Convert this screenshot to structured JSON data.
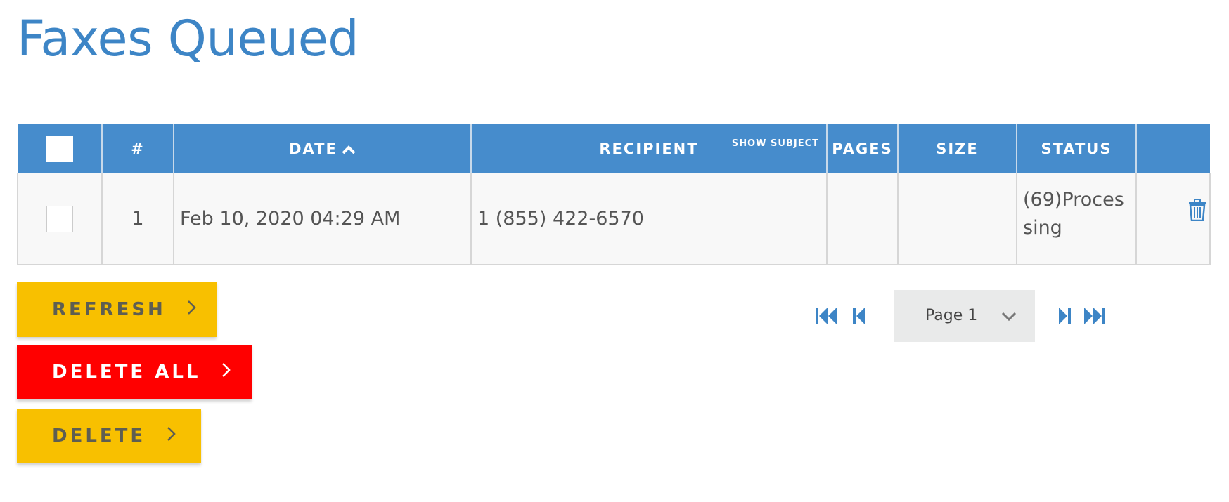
{
  "page": {
    "title": "Faxes Queued"
  },
  "table": {
    "headers": {
      "number": "#",
      "date": "DATE",
      "recipient": "RECIPIENT",
      "show_subject": "SHOW SUBJECT",
      "pages": "PAGES",
      "size": "SIZE",
      "status": "STATUS"
    },
    "sort": {
      "column": "DATE",
      "direction": "ascending",
      "icon": "chevron-up-icon"
    },
    "rows": [
      {
        "number": "1",
        "date": "Feb 10, 2020 04:29 AM",
        "recipient": "1 (855) 422-6570",
        "pages": "",
        "size": "",
        "status": "(69)Processing",
        "checked": false
      }
    ]
  },
  "actions": {
    "refresh": "REFRESH",
    "delete_all": "DELETE ALL",
    "delete": "DELETE"
  },
  "pagination": {
    "current_page": "Page 1",
    "icons": [
      "first-page-icon",
      "previous-page-icon",
      "next-page-icon",
      "last-page-icon"
    ]
  },
  "colors": {
    "title": "#3d85c6",
    "header_bg": "#468ccc",
    "yellow_button": "#f8c000",
    "red_button": "#ff0000",
    "icon_blue": "#3d85c6"
  }
}
